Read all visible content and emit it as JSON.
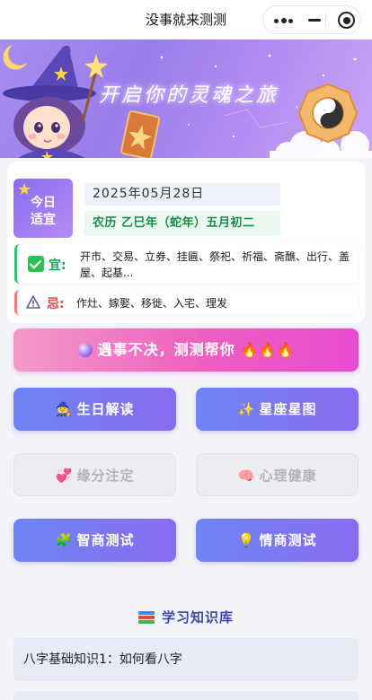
{
  "navbar": {
    "title": "没事就来测测"
  },
  "banner": {
    "title": "开启你的灵魂之旅"
  },
  "today": {
    "badge_line1": "今日",
    "badge_line2": "适宜",
    "date": "2025年05月28日",
    "lunar": "农历 乙巳年（蛇年）五月初二",
    "yi_label": "宜:",
    "yi_text": "开市、交易、立券、挂匾、祭祀、祈福、斋醮、出行、盖屋、起基...",
    "ji_label": "忌:",
    "ji_text": "作灶、嫁娶、移徙、入宅、理发"
  },
  "cta": {
    "label": "遇事不决，测测帮你",
    "flames": "🔥🔥🔥"
  },
  "buttons": [
    {
      "label": "生日解读",
      "icon": "wizard-icon",
      "glyph": "🧙",
      "state": "active"
    },
    {
      "label": "星座星图",
      "icon": "sparkles-icon",
      "glyph": "✨",
      "state": "active"
    },
    {
      "label": "缘分注定",
      "icon": "heart-icon",
      "glyph": "💞",
      "state": "disabled"
    },
    {
      "label": "心理健康",
      "icon": "brain-icon",
      "glyph": "🧠",
      "state": "disabled"
    },
    {
      "label": "智商测试",
      "icon": "puzzle-icon",
      "glyph": "🧩",
      "state": "active"
    },
    {
      "label": "情商测试",
      "icon": "lightbulb-icon",
      "glyph": "💡",
      "state": "active"
    }
  ],
  "knowledge": {
    "title": "学习知识库",
    "items": [
      {
        "label": "八字基础知识1：如何看八字"
      }
    ]
  },
  "colors": {
    "accent": "#7b7cf0",
    "cta_pink": "#ee5fc0",
    "yi_green": "#18a35a",
    "ji_red": "#e04b4b"
  }
}
